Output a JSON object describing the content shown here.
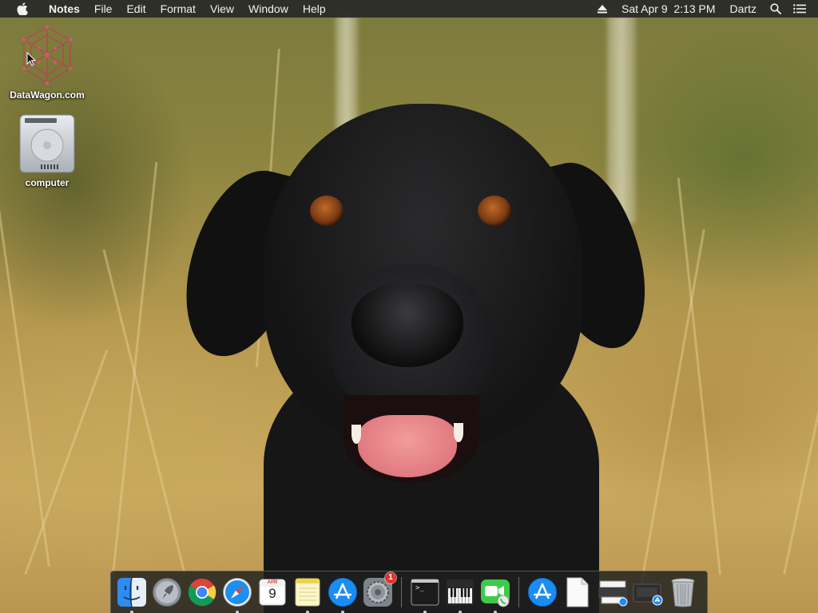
{
  "menubar": {
    "app_name": "Notes",
    "items": [
      "File",
      "Edit",
      "Format",
      "View",
      "Window",
      "Help"
    ],
    "status": {
      "datetime": "Sat Apr 9  2:13 PM",
      "user": "Dartz"
    },
    "icons": [
      "apple-icon",
      "eject-icon",
      "spotlight-search-icon",
      "notification-center-icon"
    ]
  },
  "desktop": {
    "icons": [
      {
        "label": "DataWagon.com",
        "icon": "datawagon-logo-icon"
      },
      {
        "label": "computer",
        "icon": "hard-drive-icon"
      }
    ]
  },
  "dock": {
    "apps": [
      {
        "name": "Finder",
        "icon": "finder-icon",
        "running": true
      },
      {
        "name": "Launchpad",
        "icon": "launchpad-icon",
        "running": false
      },
      {
        "name": "Google Chrome",
        "icon": "chrome-icon",
        "running": false
      },
      {
        "name": "Safari",
        "icon": "safari-icon",
        "running": true
      },
      {
        "name": "Calendar",
        "icon": "calendar-icon",
        "running": false,
        "month": "APR",
        "day": "9"
      },
      {
        "name": "Notes",
        "icon": "notes-icon",
        "running": true
      },
      {
        "name": "App Store",
        "icon": "app-store-icon",
        "running": true
      },
      {
        "name": "System Preferences",
        "icon": "system-preferences-icon",
        "running": true,
        "badge": "1"
      },
      {
        "name": "Terminal",
        "icon": "terminal-icon",
        "running": true,
        "text": ">_"
      },
      {
        "name": "Piano",
        "icon": "piano-icon",
        "running": true
      },
      {
        "name": "FaceTime",
        "icon": "facetime-icon",
        "running": true
      }
    ],
    "stacks": [
      {
        "name": "Applications",
        "icon": "app-store-folder-icon"
      },
      {
        "name": "Document",
        "icon": "document-icon"
      },
      {
        "name": "Printer",
        "icon": "printer-icon"
      },
      {
        "name": "Downloads",
        "icon": "installer-icon"
      },
      {
        "name": "Trash",
        "icon": "trash-icon"
      }
    ]
  },
  "colors": {
    "menubar_bg": "#282828",
    "dock_bg": "#1e1e1e",
    "badge": "#e8322c",
    "finder_blue": "#2f8cf3",
    "facetime_green": "#3dc94a"
  }
}
